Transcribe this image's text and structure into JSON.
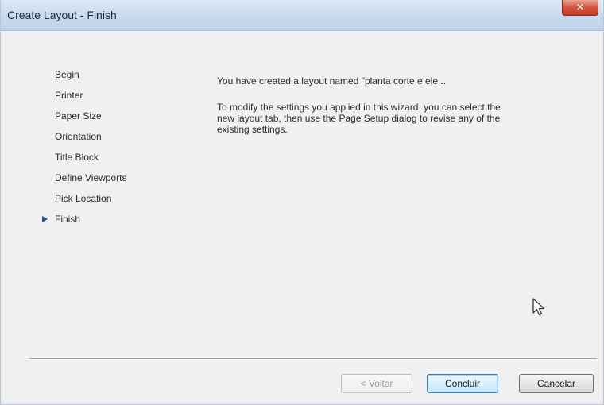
{
  "window": {
    "title": "Create Layout - Finish",
    "close_label": "✕"
  },
  "steps": [
    {
      "label": "Begin",
      "current": false
    },
    {
      "label": "Printer",
      "current": false
    },
    {
      "label": "Paper Size",
      "current": false
    },
    {
      "label": "Orientation",
      "current": false
    },
    {
      "label": "Title Block",
      "current": false
    },
    {
      "label": "Define Viewports",
      "current": false
    },
    {
      "label": "Pick Location",
      "current": false
    },
    {
      "label": "Finish",
      "current": true
    }
  ],
  "message": {
    "line1": "You have created a layout named \"planta corte e ele...",
    "line2": "To modify the settings you applied in this wizard, you can select the new layout tab, then use the Page Setup dialog to revise any of the existing settings."
  },
  "buttons": {
    "back_label": "< Voltar",
    "finish_label": "Concluir",
    "cancel_label": "Cancelar"
  },
  "icons": {
    "current_step": "play-arrow-icon",
    "cursor": "mouse-pointer-icon"
  }
}
